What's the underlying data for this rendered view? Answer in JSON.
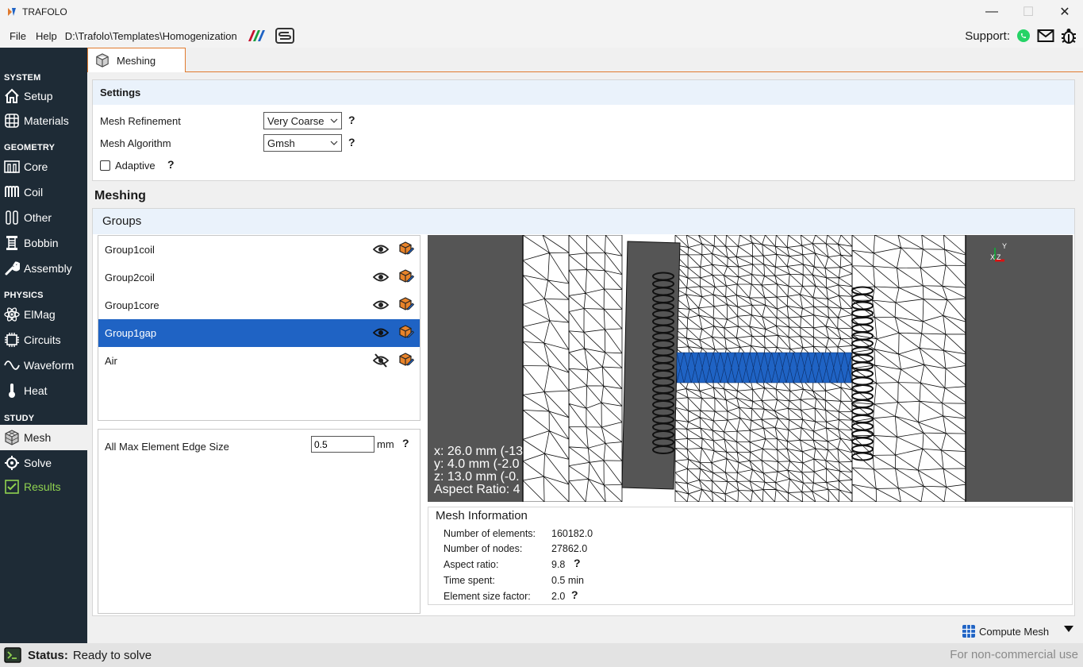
{
  "app": {
    "title": "TRAFOLO"
  },
  "menu": {
    "file": "File",
    "help": "Help",
    "path": "D:\\Trafolo\\Templates\\Homogenization"
  },
  "support": {
    "label": "Support:"
  },
  "sidebar": {
    "sections": {
      "system": "SYSTEM",
      "geometry": "GEOMETRY",
      "physics": "PHYSICS",
      "study": "STUDY"
    },
    "items": {
      "setup": "Setup",
      "materials": "Materials",
      "core": "Core",
      "coil": "Coil",
      "other": "Other",
      "bobbin": "Bobbin",
      "assembly": "Assembly",
      "elmag": "ElMag",
      "circuits": "Circuits",
      "waveform": "Waveform",
      "heat": "Heat",
      "mesh": "Mesh",
      "solve": "Solve",
      "results": "Results"
    }
  },
  "tab": {
    "label": "Meshing"
  },
  "settings": {
    "title": "Settings",
    "mesh_refinement_label": "Mesh Refinement",
    "mesh_refinement_value": "Very Coarse",
    "mesh_algorithm_label": "Mesh Algorithm",
    "mesh_algorithm_value": "Gmsh",
    "adaptive_label": "Adaptive",
    "help": "?"
  },
  "meshing": {
    "title": "Meshing",
    "groups_title": "Groups",
    "groups": [
      {
        "name": "Group1coil",
        "visible": true
      },
      {
        "name": "Group2coil",
        "visible": true
      },
      {
        "name": "Group1core",
        "visible": true
      },
      {
        "name": "Group1gap",
        "visible": true
      },
      {
        "name": "Air",
        "visible": false
      }
    ],
    "edge_size_label": "All Max Element Edge Size",
    "edge_size_value": "0.5",
    "edge_size_unit": "mm"
  },
  "viewport": {
    "coord_x": "x: 26.0 mm (-13",
    "coord_y": "y: 4.0 mm (-2.0",
    "coord_z": "z: 13.0 mm (-0.",
    "aspect": "Aspect Ratio: 4",
    "axis_y": "Y",
    "axis_x": "X",
    "axis_z": "Z"
  },
  "mesh_info": {
    "title": "Mesh Information",
    "elements_label": "Number of elements:",
    "elements_value": "160182.0",
    "nodes_label": "Number of nodes:",
    "nodes_value": "27862.0",
    "aspect_label": "Aspect ratio:",
    "aspect_value": "9.8",
    "time_label": "Time spent:",
    "time_value": "0.5 min",
    "factor_label": "Element size factor:",
    "factor_value": "2.0"
  },
  "actions": {
    "compute": "Compute Mesh"
  },
  "status": {
    "label": "Status:",
    "value": "Ready to solve",
    "license": "For non-commercial use"
  },
  "colors": {
    "sidebar": "#1e2b36",
    "accent": "#e07a2e",
    "selected": "#1f63c4",
    "results": "#8fd14f"
  }
}
